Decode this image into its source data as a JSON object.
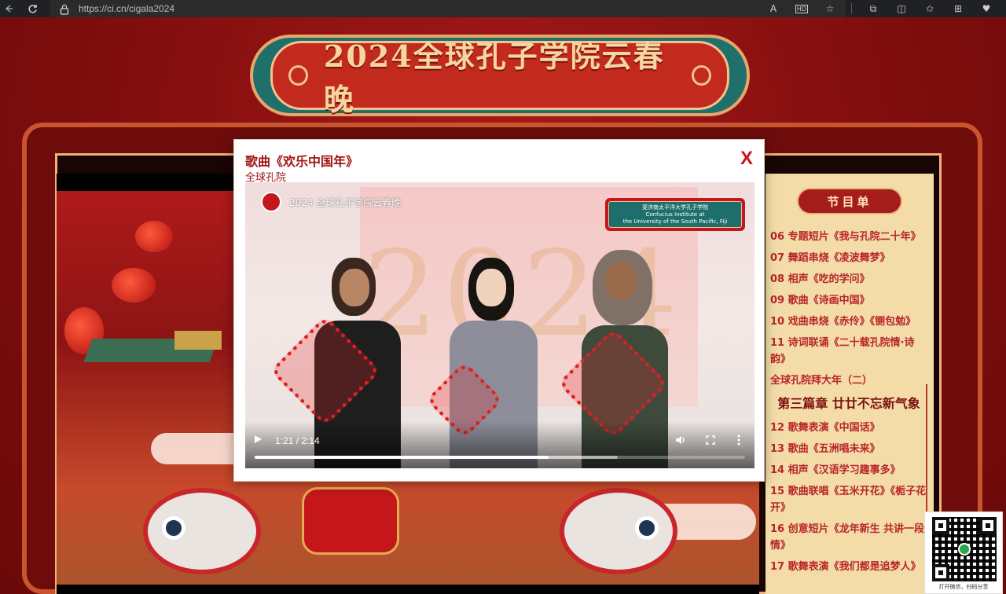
{
  "browser": {
    "url": "https://ci.cn/cigala2024",
    "icons": [
      "back-icon",
      "refresh-icon",
      "lock-icon",
      "read-aloud-icon",
      "hd-icon",
      "favorite-icon",
      "extensions-icon",
      "split-screen-icon",
      "favorites-bar-icon",
      "collections-icon",
      "browser-essentials-icon"
    ],
    "read_aloud_label": "A",
    "hd_label": "HD"
  },
  "page": {
    "banner_title": "2024全球孔子学院云春晚",
    "program_title": "节目单",
    "program_items": [
      {
        "label": "06 专题短片《我与孔院二十年》",
        "type": "item"
      },
      {
        "label": "07 舞蹈串烧《凌波舞梦》",
        "type": "item"
      },
      {
        "label": "08 相声《吃的学问》",
        "type": "item"
      },
      {
        "label": "09 歌曲《诗画中国》",
        "type": "item"
      },
      {
        "label": "10 戏曲串烧《赤伶》《铡包勉》",
        "type": "item"
      },
      {
        "label": "11 诗词联诵《二十载孔院情·诗韵》",
        "type": "item"
      },
      {
        "label": "全球孔院拜大年（二）",
        "type": "item"
      },
      {
        "label": "第三篇章 廿廿不忘新气象",
        "type": "section"
      },
      {
        "label": "12 歌舞表演《中国话》",
        "type": "item"
      },
      {
        "label": "13 歌曲《五洲唱未来》",
        "type": "item"
      },
      {
        "label": "14 相声《汉语学习趣事多》",
        "type": "item"
      },
      {
        "label": "15 歌曲联唱《玉米开花》《栀子花开》",
        "type": "item"
      },
      {
        "label": "16 创意短片《龙年新生 共讲一段情》",
        "type": "item"
      },
      {
        "label": "17 歌舞表演《我们都是追梦人》",
        "type": "item"
      }
    ],
    "qr_caption": "打开微信，扫码分享"
  },
  "modal": {
    "title": "歌曲《欢乐中国年》",
    "subtitle": "全球孔院",
    "close_label": "X",
    "video": {
      "overlay_logo_text": "2024 全球孔子学院云春晚",
      "institute_cn": "斐济南太平洋大学孔子学院",
      "institute_en_1": "Confucius Institute at",
      "institute_en_2": "the University of the South Pacific, Fiji",
      "backdrop_year": "2024",
      "current_time": "1:21",
      "duration": "2:14",
      "time_display": "1:21 / 2:14",
      "played_fraction": 0.6,
      "buffered_fraction": 0.74,
      "icons": [
        "play-icon",
        "volume-icon",
        "fullscreen-icon",
        "more-options-icon"
      ]
    }
  },
  "colors": {
    "accent": "#c4161b",
    "page_bg": "#8a0f0f",
    "program_bg": "#f3dca8",
    "banner_teal": "#1f6f6b"
  }
}
